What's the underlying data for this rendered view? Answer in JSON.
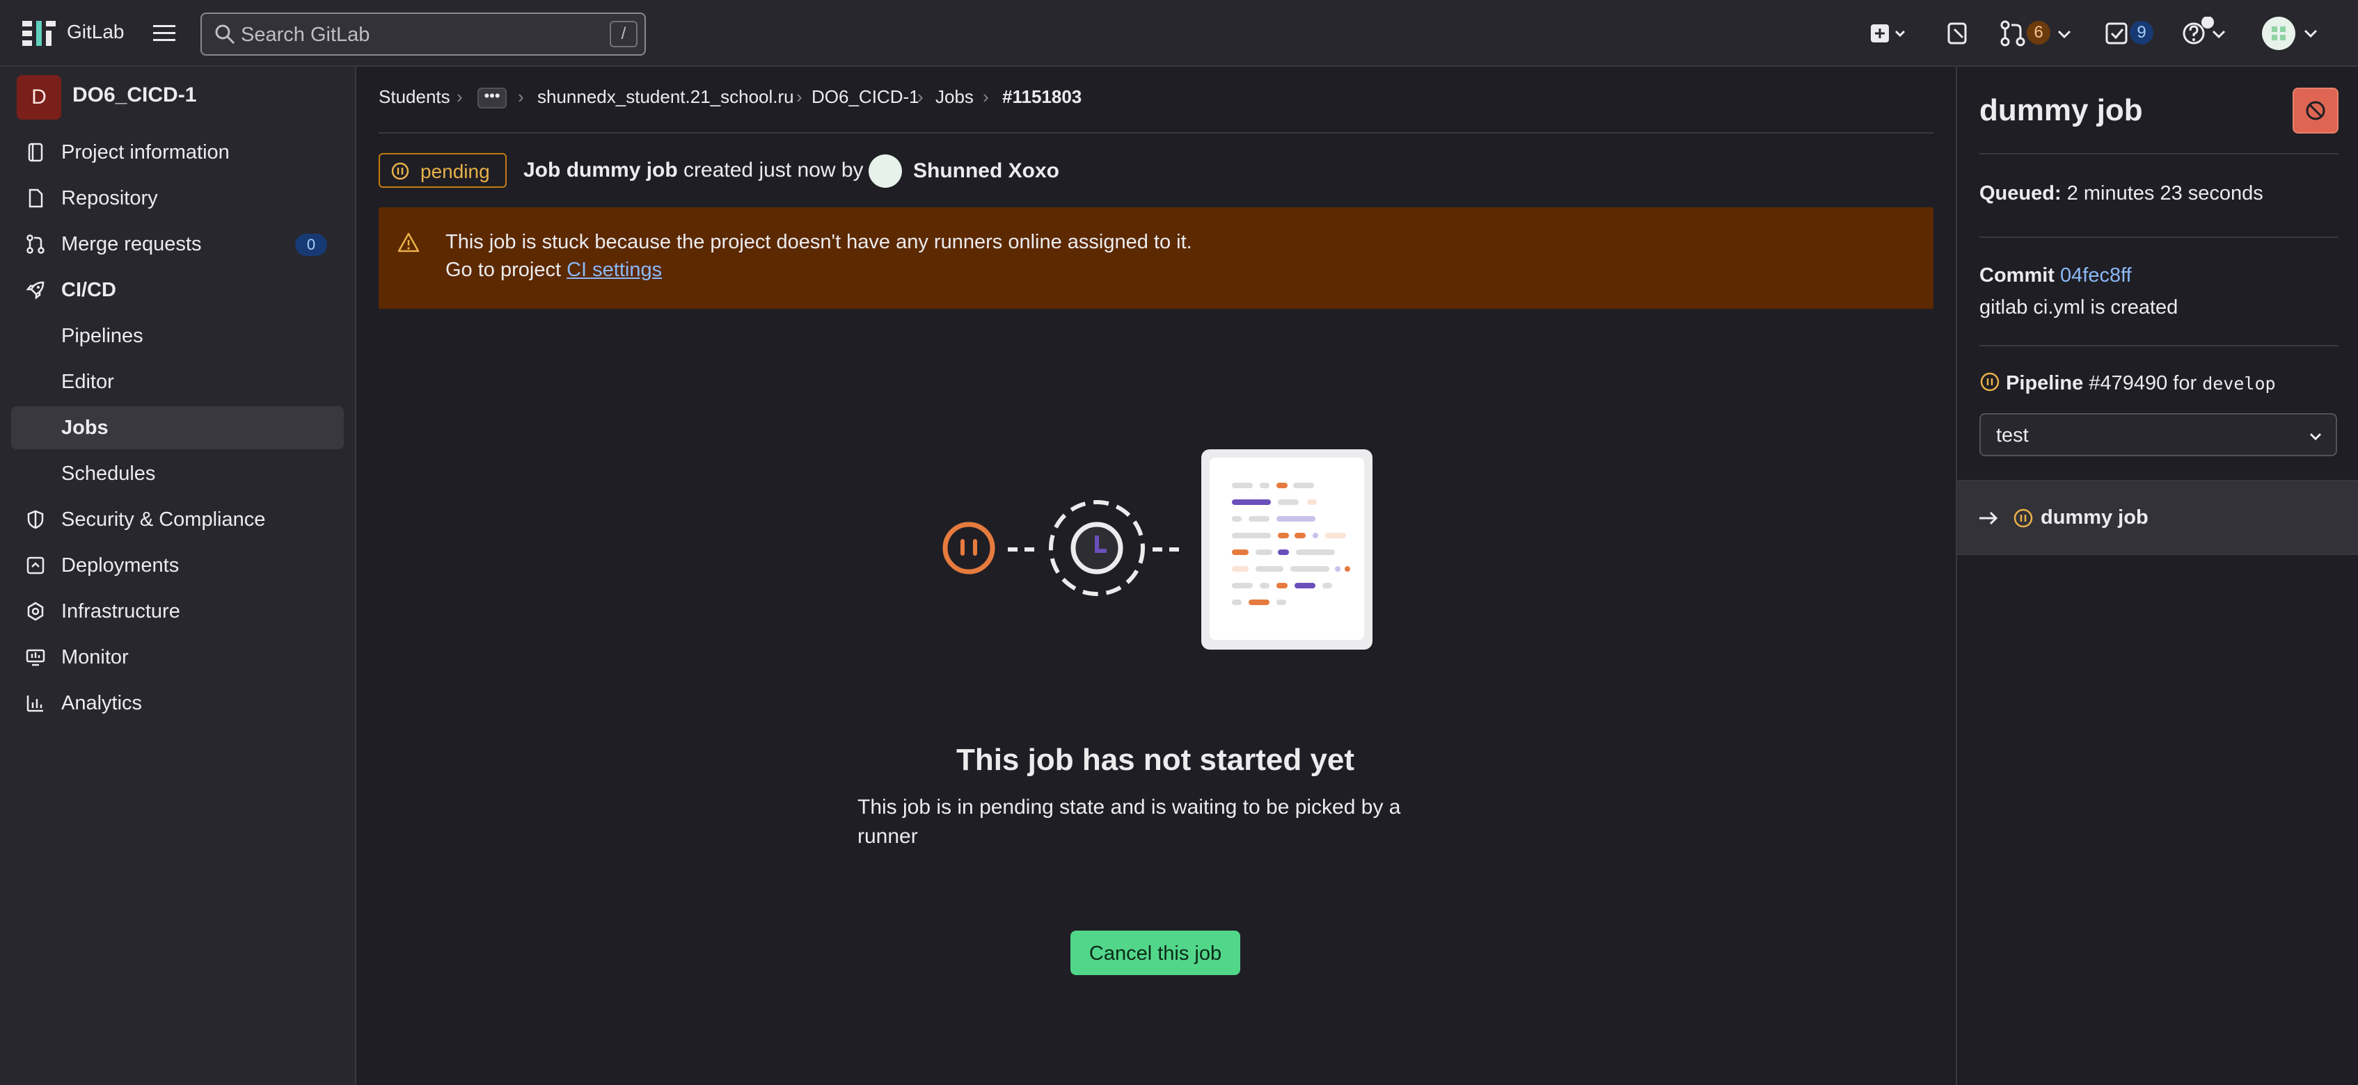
{
  "app": {
    "brand": "GitLab"
  },
  "search": {
    "placeholder": "Search GitLab",
    "shortcut": "/"
  },
  "topbar": {
    "merge_requests_count": "6",
    "todos_count": "9"
  },
  "project": {
    "avatar_letter": "D",
    "name": "DO6_CICD-1"
  },
  "sidebar": {
    "items": [
      {
        "label": "Project information",
        "icon": "project-icon"
      },
      {
        "label": "Repository",
        "icon": "doc-icon"
      },
      {
        "label": "Merge requests",
        "icon": "merge-request-icon",
        "count": "0"
      },
      {
        "label": "CI/CD",
        "icon": "rocket-icon"
      },
      {
        "label": "Pipelines"
      },
      {
        "label": "Editor"
      },
      {
        "label": "Jobs"
      },
      {
        "label": "Schedules"
      },
      {
        "label": "Security & Compliance",
        "icon": "shield-icon"
      },
      {
        "label": "Deployments",
        "icon": "deployments-icon"
      },
      {
        "label": "Infrastructure",
        "icon": "cloud-gear-icon"
      },
      {
        "label": "Monitor",
        "icon": "monitor-icon"
      },
      {
        "label": "Analytics",
        "icon": "chart-icon"
      }
    ]
  },
  "breadcrumb": {
    "items": [
      "Students",
      "shunnedx_student.21_school.ru",
      "DO6_CICD-1",
      "Jobs",
      "#1151803"
    ],
    "more": "•••"
  },
  "job": {
    "status": "pending",
    "header_prefix": "Job",
    "name": "dummy job",
    "header_middle": "created just now by",
    "author": "Shunned Xoxo"
  },
  "alert": {
    "line1": "This job is stuck because the project doesn't have any runners online assigned to it.",
    "line2_prefix": "Go to project",
    "line2_link": "CI settings"
  },
  "empty_state": {
    "title": "This job has not started yet",
    "description": "This job is in pending state and is waiting to be picked by a runner",
    "button": "Cancel this job"
  },
  "right_panel": {
    "title": "dummy job",
    "queued_label": "Queued:",
    "queued_value": "2 minutes 23 seconds",
    "commit_label": "Commit",
    "commit_sha": "04fec8ff",
    "commit_message": "gitlab ci.yml is created",
    "pipeline_label": "Pipeline",
    "pipeline_id": "#479490",
    "pipeline_for": "for",
    "pipeline_ref": "develop",
    "stage": "test",
    "job_item": "dummy job"
  },
  "colors": {
    "pending": "#e9b14a",
    "alert_bg": "#5c2900",
    "accent_link": "#8ab9f7",
    "cancel_button": "#52d68a",
    "danger": "#dd6552"
  }
}
